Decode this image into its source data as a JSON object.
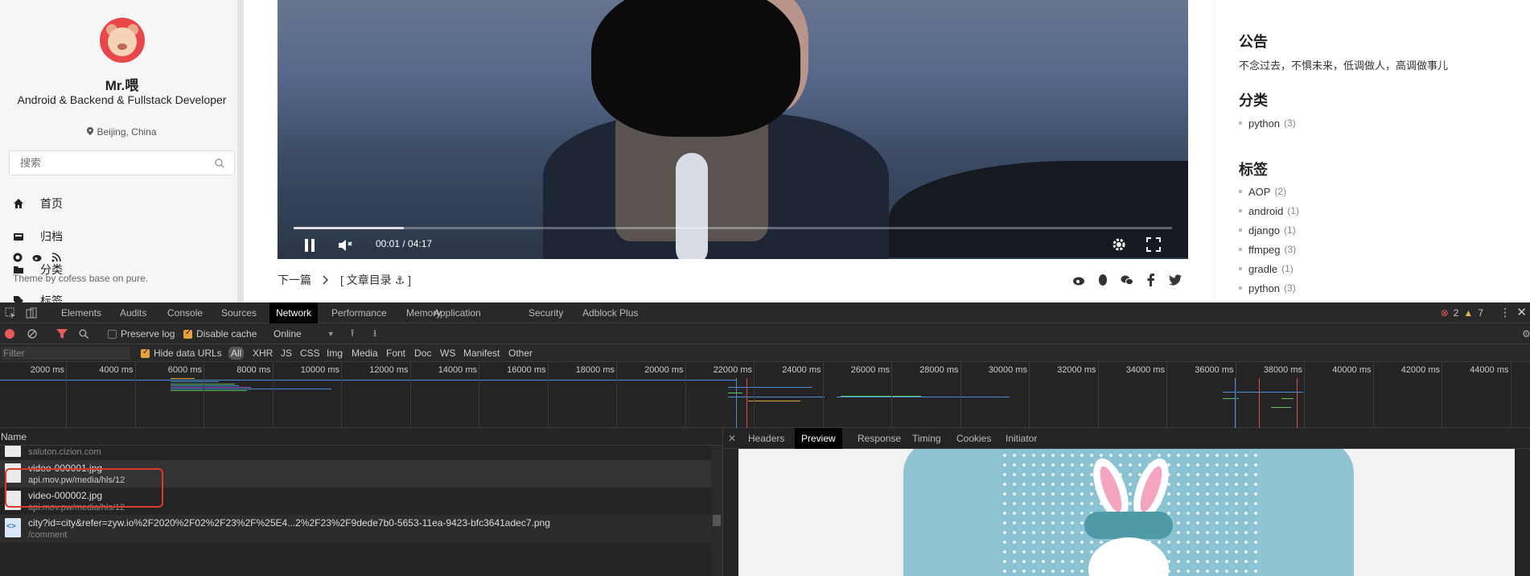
{
  "profile": {
    "name": "Mr.喂",
    "role": "Android & Backend & Fullstack Developer",
    "location": "Beijing, China"
  },
  "search": {
    "placeholder": "搜索"
  },
  "nav": {
    "home": "首页",
    "archive": "归档",
    "category": "分类",
    "tags_partial": "标签"
  },
  "footer_note": "Theme by cofess base on pure.",
  "video": {
    "time": "00:01 / 04:17",
    "progress": 0.125
  },
  "post_nav": {
    "next": "下一篇",
    "toc": "[ 文章目录 ⚓ ]"
  },
  "right": {
    "notice_title": "公告",
    "notice_text": "不念过去，不惧未来，低调做人，高调做事儿",
    "category_title": "分类",
    "categories": [
      {
        "name": "python",
        "count": "(3)"
      }
    ],
    "tags_title": "标签",
    "tags": [
      {
        "name": "AOP",
        "count": "(2)"
      },
      {
        "name": "android",
        "count": "(1)"
      },
      {
        "name": "django",
        "count": "(1)"
      },
      {
        "name": "ffmpeg",
        "count": "(3)"
      },
      {
        "name": "gradle",
        "count": "(1)"
      },
      {
        "name": "python",
        "count": "(3)"
      }
    ]
  },
  "devtools": {
    "tabs": [
      "Elements",
      "Audits",
      "Console",
      "Sources",
      "Network",
      "Performance",
      "Memory",
      "Application",
      "Security",
      "Adblock Plus"
    ],
    "active_tab": "Network",
    "errors": "2",
    "warnings": "7",
    "toolbar": {
      "preserve_log": "Preserve log",
      "disable_cache": "Disable cache",
      "throttle": "Online"
    },
    "filter": {
      "placeholder": "Filter",
      "hide_data_urls": "Hide data URLs",
      "all": "All",
      "types": [
        "XHR",
        "JS",
        "CSS",
        "Img",
        "Media",
        "Font",
        "Doc",
        "WS",
        "Manifest",
        "Other"
      ]
    },
    "timeline_ticks": [
      "2000 ms",
      "4000 ms",
      "6000 ms",
      "8000 ms",
      "10000 ms",
      "12000 ms",
      "14000 ms",
      "16000 ms",
      "18000 ms",
      "20000 ms",
      "22000 ms",
      "24000 ms",
      "26000 ms",
      "28000 ms",
      "30000 ms",
      "32000 ms",
      "34000 ms",
      "36000 ms",
      "38000 ms",
      "40000 ms",
      "42000 ms",
      "44000 ms"
    ],
    "requests_header": "Name",
    "requests": [
      {
        "name": "saluton.cizion.com",
        "path": ""
      },
      {
        "name": "video-000001.jpg",
        "path": "api.mov.pw/media/hls/12"
      },
      {
        "name": "video-000002.jpg",
        "path": "api.mov.pw/media/hls/12"
      },
      {
        "name": "city?id=city&refer=zyw.io%2F2020%2F02%2F23%2F%25E4...2%2F23%2F9dede7b0-5653-11ea-9423-bfc3641adec7.png",
        "path": "/comment"
      }
    ],
    "detail_tabs": [
      "Headers",
      "Preview",
      "Response",
      "Timing",
      "Cookies",
      "Initiator"
    ],
    "detail_active": "Preview"
  },
  "colors": {
    "devtools_bg": "#242424",
    "highlight_box": "#d93a2b",
    "error": "#e85b5b",
    "warning": "#e8b54a"
  }
}
